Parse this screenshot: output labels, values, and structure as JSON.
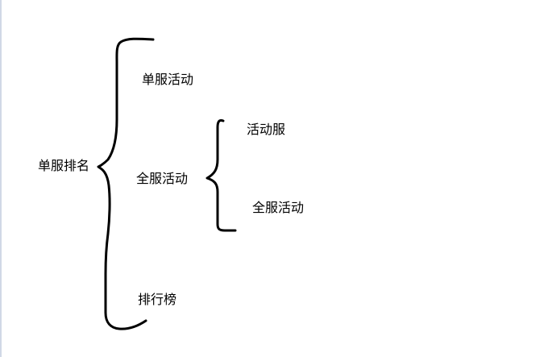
{
  "diagram": {
    "root": {
      "label": "单服排名"
    },
    "children": [
      {
        "label": "单服活动"
      },
      {
        "label": "全服活动",
        "children": [
          {
            "label": "活动服"
          },
          {
            "label": "全服活动"
          }
        ]
      },
      {
        "label": "排行榜"
      }
    ]
  },
  "colors": {
    "stroke": "#000000",
    "text": "#000000",
    "background": "#ffffff"
  }
}
